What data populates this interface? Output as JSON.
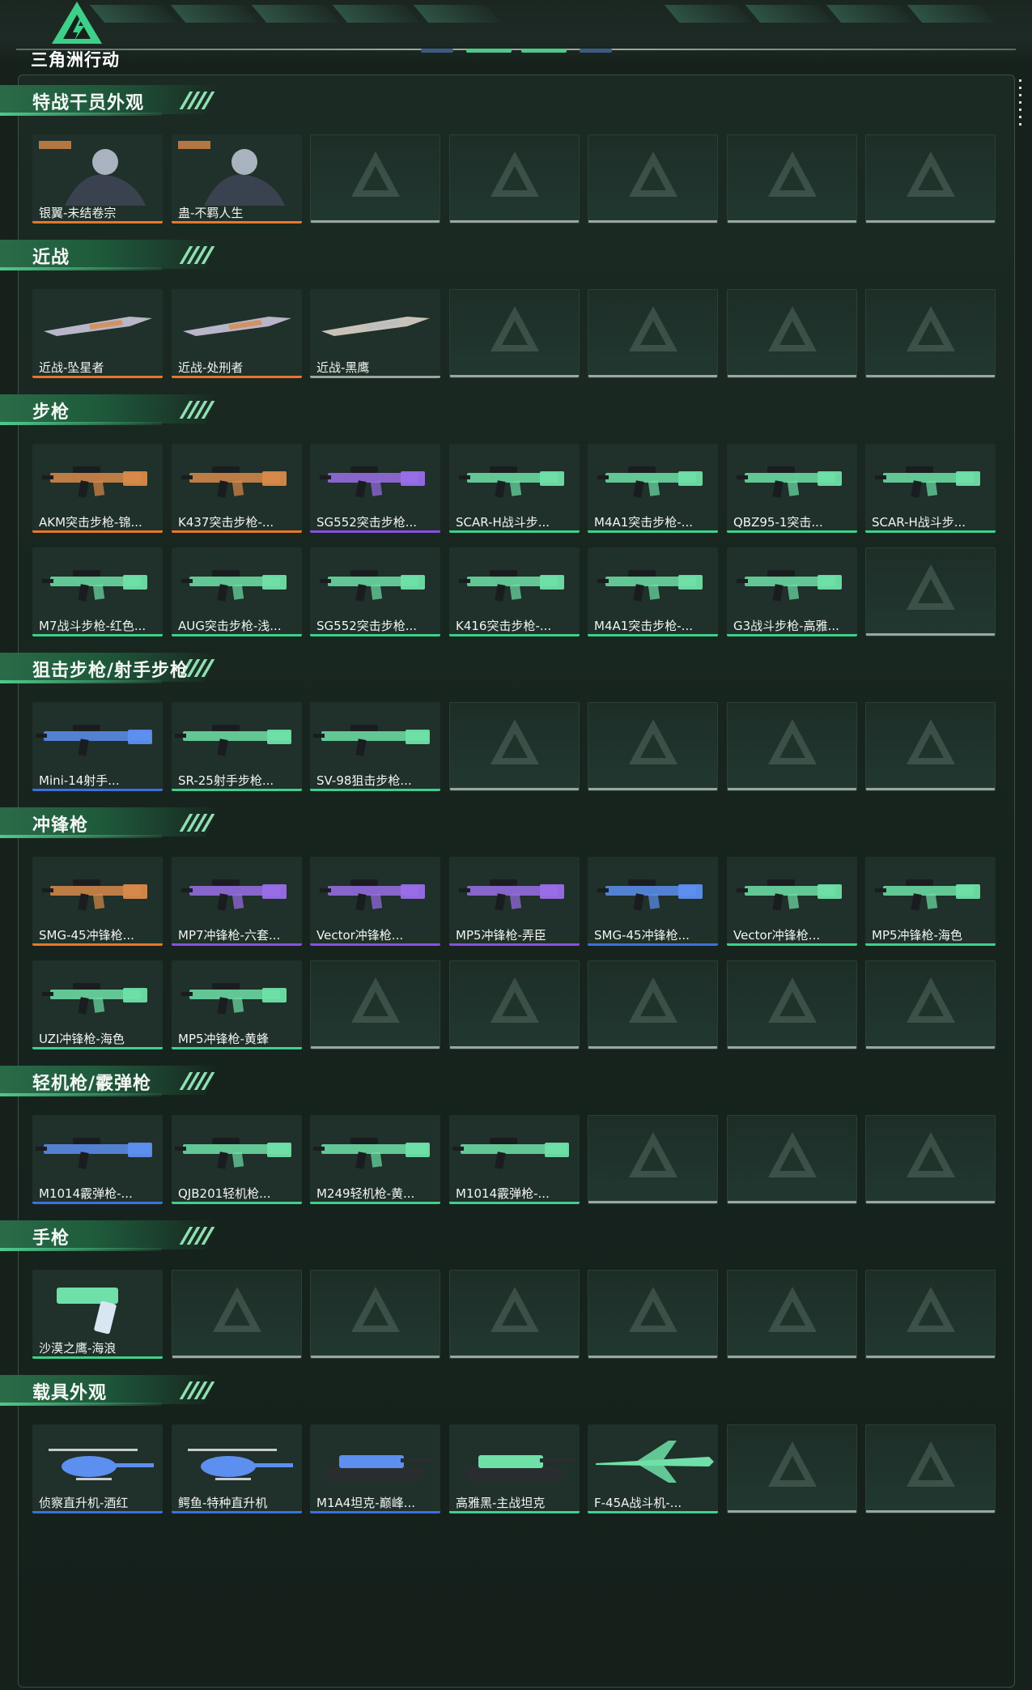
{
  "app": {
    "title": "三角洲行动"
  },
  "colors": {
    "rarity_orange": "#e8772b",
    "rarity_purple": "#8a4fe0",
    "rarity_green": "#3ed08a",
    "rarity_blue": "#3d6fe0",
    "rarity_grey": "#9aa6a0",
    "accent": "#4fc98a"
  },
  "sections": [
    {
      "title": "特战干员外观",
      "items": [
        {
          "label": "银翼-未结卷宗",
          "rarity": "orange",
          "icon": "operator-portrait-icon"
        },
        {
          "label": "蛊-不羁人生",
          "rarity": "orange",
          "icon": "operator-portrait-icon"
        }
      ]
    },
    {
      "title": "近战",
      "items": [
        {
          "label": "近战-坠星者",
          "rarity": "orange",
          "icon": "melee-blade-icon"
        },
        {
          "label": "近战-处刑者",
          "rarity": "orange",
          "icon": "melee-axe-icon"
        },
        {
          "label": "近战-黑鹰",
          "rarity": "grey",
          "icon": "knife-icon"
        }
      ]
    },
    {
      "title": "步枪",
      "items": [
        {
          "label": "AKM突击步枪-锦...",
          "rarity": "orange",
          "icon": "rifle-icon"
        },
        {
          "label": "K437突击步枪-...",
          "rarity": "orange",
          "icon": "rifle-icon"
        },
        {
          "label": "SG552突击步枪...",
          "rarity": "purple",
          "icon": "rifle-icon"
        },
        {
          "label": "SCAR-H战斗步...",
          "rarity": "green",
          "icon": "rifle-icon"
        },
        {
          "label": "M4A1突击步枪-...",
          "rarity": "green",
          "icon": "rifle-icon"
        },
        {
          "label": "QBZ95-1突击...",
          "rarity": "green",
          "icon": "rifle-icon"
        },
        {
          "label": "SCAR-H战斗步...",
          "rarity": "green",
          "icon": "rifle-icon"
        },
        {
          "label": "M7战斗步枪-红色...",
          "rarity": "green",
          "icon": "rifle-icon"
        },
        {
          "label": "AUG突击步枪-浅...",
          "rarity": "green",
          "icon": "rifle-icon"
        },
        {
          "label": "SG552突击步枪...",
          "rarity": "green",
          "icon": "rifle-icon"
        },
        {
          "label": "K416突击步枪-...",
          "rarity": "green",
          "icon": "rifle-icon"
        },
        {
          "label": "M4A1突击步枪-...",
          "rarity": "green",
          "icon": "rifle-icon"
        },
        {
          "label": "G3战斗步枪-高雅...",
          "rarity": "green",
          "icon": "rifle-icon"
        }
      ]
    },
    {
      "title": "狙击步枪/射手步枪",
      "items": [
        {
          "label": "Mini-14射手...",
          "rarity": "blue",
          "icon": "marksman-rifle-icon"
        },
        {
          "label": "SR-25射手步枪...",
          "rarity": "green",
          "icon": "marksman-rifle-icon"
        },
        {
          "label": "SV-98狙击步枪...",
          "rarity": "green",
          "icon": "sniper-rifle-icon"
        }
      ]
    },
    {
      "title": "冲锋枪",
      "items": [
        {
          "label": "SMG-45冲锋枪...",
          "rarity": "orange",
          "icon": "smg-icon"
        },
        {
          "label": "MP7冲锋枪-六套...",
          "rarity": "purple",
          "icon": "smg-icon"
        },
        {
          "label": "Vector冲锋枪...",
          "rarity": "purple",
          "icon": "smg-icon"
        },
        {
          "label": "MP5冲锋枪-弄臣",
          "rarity": "purple",
          "icon": "smg-icon"
        },
        {
          "label": "SMG-45冲锋枪...",
          "rarity": "blue",
          "icon": "smg-icon"
        },
        {
          "label": "Vector冲锋枪...",
          "rarity": "green",
          "icon": "smg-icon"
        },
        {
          "label": "MP5冲锋枪-海色",
          "rarity": "green",
          "icon": "smg-icon"
        },
        {
          "label": "UZI冲锋枪-海色",
          "rarity": "green",
          "icon": "smg-icon"
        },
        {
          "label": "MP5冲锋枪-黄蜂",
          "rarity": "green",
          "icon": "smg-icon"
        }
      ]
    },
    {
      "title": "轻机枪/霰弹枪",
      "items": [
        {
          "label": "M1014霰弹枪-...",
          "rarity": "blue",
          "icon": "shotgun-icon"
        },
        {
          "label": "QJB201轻机枪...",
          "rarity": "green",
          "icon": "lmg-icon"
        },
        {
          "label": "M249轻机枪-黄...",
          "rarity": "green",
          "icon": "lmg-icon"
        },
        {
          "label": "M1014霰弹枪-...",
          "rarity": "green",
          "icon": "shotgun-icon"
        }
      ]
    },
    {
      "title": "手枪",
      "items": [
        {
          "label": "沙漠之鹰-海浪",
          "rarity": "green",
          "icon": "pistol-icon"
        }
      ]
    },
    {
      "title": "载具外观",
      "items": [
        {
          "label": "侦察直升机-酒红",
          "rarity": "blue",
          "icon": "helicopter-icon"
        },
        {
          "label": "鳄鱼-特种直升机",
          "rarity": "blue",
          "icon": "attack-helicopter-icon"
        },
        {
          "label": "M1A4坦克-巅峰...",
          "rarity": "blue",
          "icon": "tank-icon"
        },
        {
          "label": "高雅黑-主战坦克",
          "rarity": "green",
          "icon": "tank-icon"
        },
        {
          "label": "F-45A战斗机-...",
          "rarity": "green",
          "icon": "fighter-jet-icon"
        }
      ]
    }
  ]
}
